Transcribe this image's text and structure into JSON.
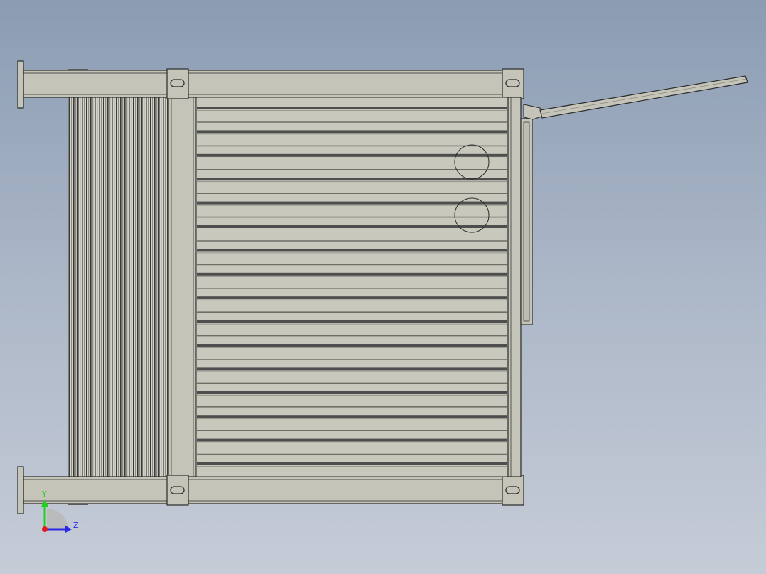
{
  "viewport": {
    "background_top": "#8b9cb3",
    "background_bottom": "#c6ccd7"
  },
  "model": {
    "body_color": "#c4c4b8",
    "edge_color": "#2a2a2a",
    "slot_color": "#4e4e4e"
  },
  "triad": {
    "y_label": "Y",
    "z_label": "Z",
    "y_color": "#1ed21e",
    "z_color": "#2a2ae6",
    "x_color": "#e01a1a"
  }
}
